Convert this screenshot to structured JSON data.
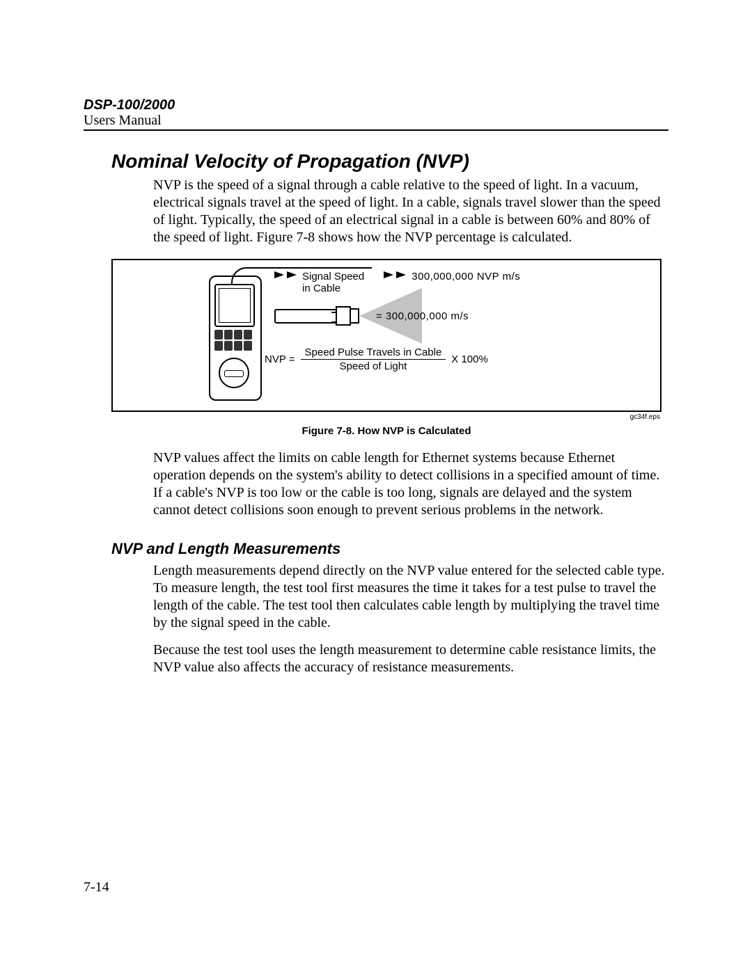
{
  "header": {
    "model": "DSP-100/2000",
    "subtitle": "Users Manual"
  },
  "section1": {
    "title": "Nominal Velocity of Propagation (NVP)",
    "p1": "NVP is the speed of a signal through a cable relative to the speed of light. In a vacuum, electrical signals travel at the speed of light. In a cable, signals travel slower than the speed of light. Typically, the speed of an electrical signal in a cable is between 60% and 80% of the speed of light. Figure 7-8 shows how the NVP percentage is calculated.",
    "p2": "NVP values affect the limits on cable length for Ethernet systems because Ethernet operation depends on the system's ability to detect collisions in a specified amount of time. If a cable's NVP is too low or the cable is too long, signals are delayed and the system cannot detect collisions soon enough to prevent serious problems in the network."
  },
  "figure": {
    "signal_label": "Signal Speed\nin Cable",
    "nvp_ms": "300,000,000 NVP m/s",
    "speed_c": "= 300,000,000 m/s",
    "formula_lhs": "NVP =",
    "formula_num": "Speed Pulse Travels in Cable",
    "formula_den": "Speed of Light",
    "formula_rhs": "X 100%",
    "eps": "gc34f.eps",
    "caption": "Figure 7-8. How NVP is Calculated"
  },
  "section2": {
    "title": "NVP and Length Measurements",
    "p1": "Length measurements depend directly on the NVP value entered for the selected cable type. To measure length, the test tool first measures the time it takes for a test pulse to travel the length of the cable. The test tool then calculates cable length by multiplying the travel time by the signal speed in the cable.",
    "p2": "Because the test tool uses the length measurement to determine cable resistance limits, the NVP value also affects the accuracy of resistance measurements."
  },
  "page_number": "7-14"
}
